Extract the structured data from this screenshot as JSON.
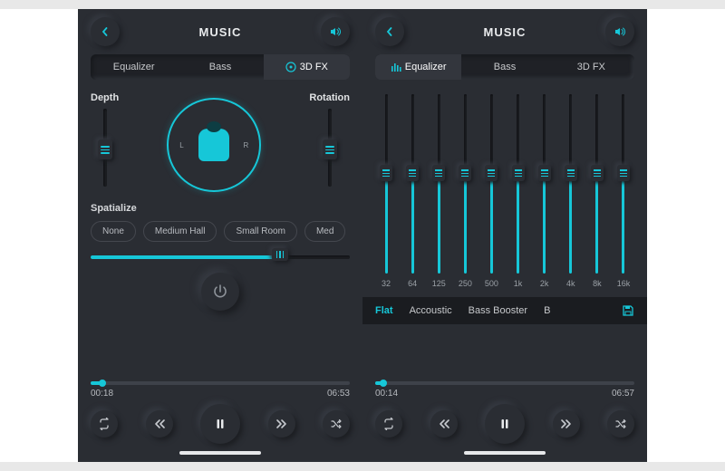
{
  "colors": {
    "accent": "#16c7d8",
    "bg": "#2a2d33"
  },
  "title": "MUSIC",
  "tabs": {
    "equalizer": "Equalizer",
    "bass": "Bass",
    "fx": "3D FX"
  },
  "left": {
    "activeTab": "fx",
    "depthLabel": "Depth",
    "rotationLabel": "Rotation",
    "dial": {
      "left": "L",
      "right": "R"
    },
    "spatialize": {
      "label": "Spatialize",
      "chips": [
        "None",
        "Medium Hall",
        "Small Room",
        "Med"
      ],
      "value": 0.73
    },
    "playback": {
      "elapsed": "00:18",
      "total": "06:53",
      "progress": 0.044
    }
  },
  "right": {
    "activeTab": "equalizer",
    "bands": [
      {
        "freq": "32",
        "value": 0.56
      },
      {
        "freq": "64",
        "value": 0.56
      },
      {
        "freq": "125",
        "value": 0.56
      },
      {
        "freq": "250",
        "value": 0.56
      },
      {
        "freq": "500",
        "value": 0.56
      },
      {
        "freq": "1k",
        "value": 0.56
      },
      {
        "freq": "2k",
        "value": 0.56
      },
      {
        "freq": "4k",
        "value": 0.56
      },
      {
        "freq": "8k",
        "value": 0.56
      },
      {
        "freq": "16k",
        "value": 0.56
      }
    ],
    "presets": [
      "Flat",
      "Accoustic",
      "Bass Booster",
      "B"
    ],
    "activePreset": "Flat",
    "playback": {
      "elapsed": "00:14",
      "total": "06:57",
      "progress": 0.033
    }
  }
}
